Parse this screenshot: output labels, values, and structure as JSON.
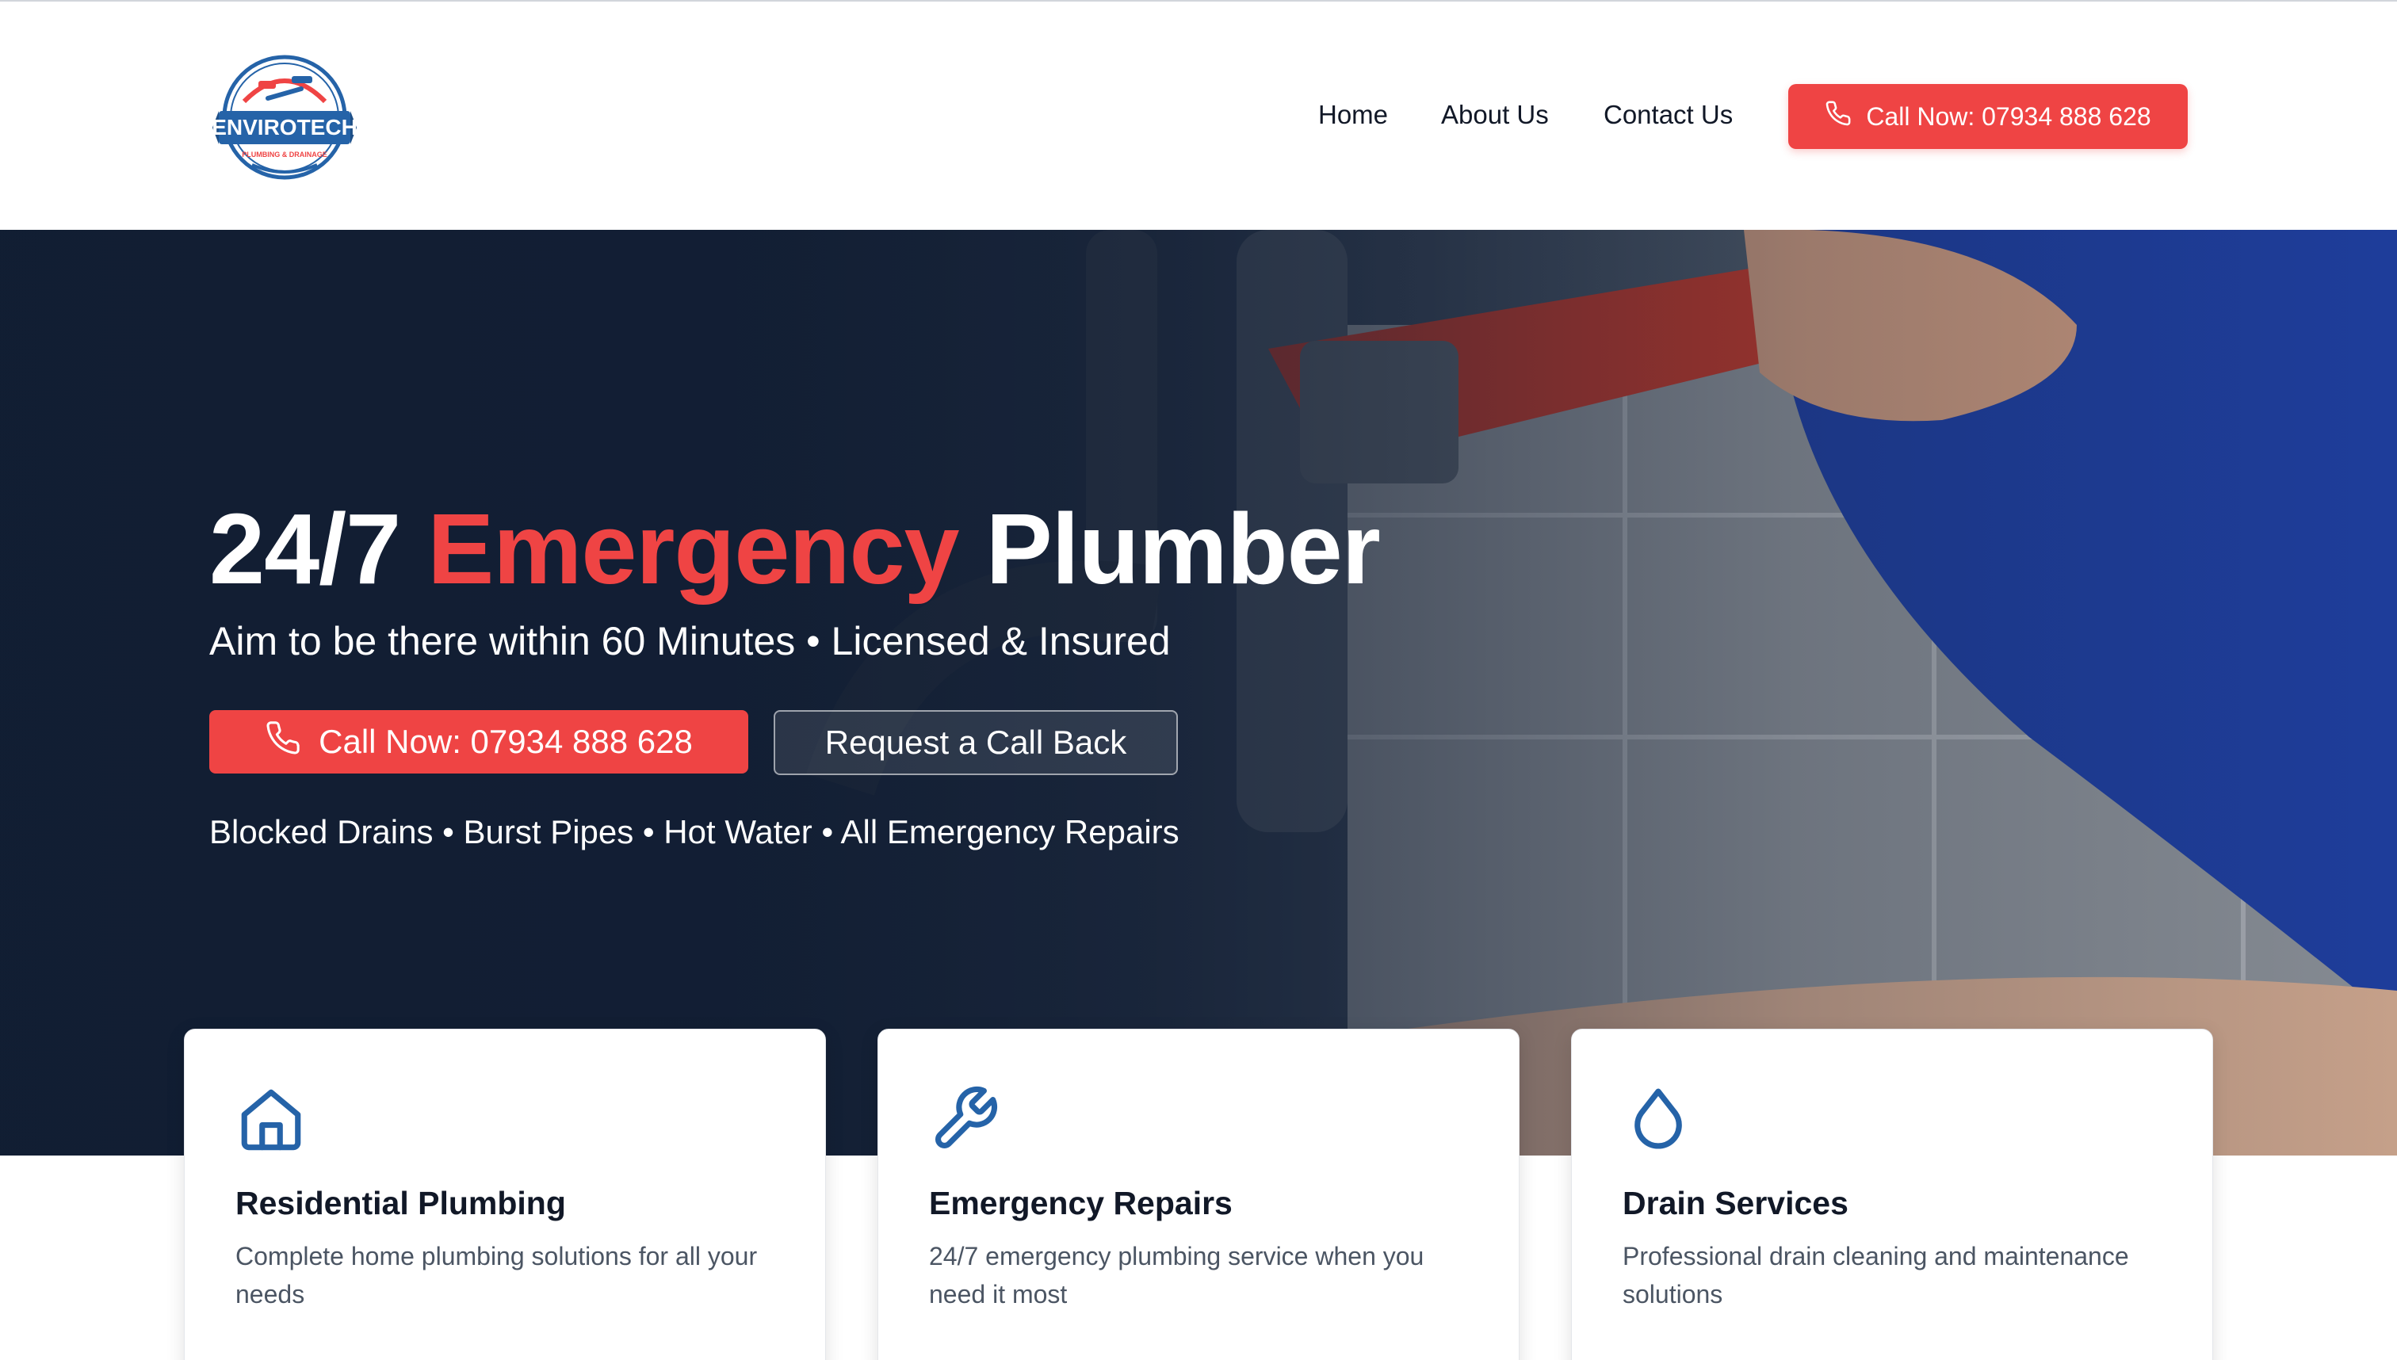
{
  "brand": {
    "logo_text": "ENVIROTECH",
    "logo_subtext": "PLUMBING & DRAINAGE"
  },
  "nav": {
    "items": [
      "Home",
      "About Us",
      "Contact Us"
    ],
    "call_button": "Call Now: 07934 888 628"
  },
  "hero": {
    "title_part1": "24/7 ",
    "title_accent": "Emergency",
    "title_part2": " Plumber",
    "subtitle": "Aim to be there within 60 Minutes • Licensed & Insured",
    "call_button": "Call Now: 07934 888 628",
    "callback_button": "Request a Call Back",
    "services_line": "Blocked Drains • Burst Pipes • Hot Water • All Emergency Repairs"
  },
  "cards": [
    {
      "icon": "house-icon",
      "title": "Residential Plumbing",
      "description": "Complete home plumbing solutions for all your needs"
    },
    {
      "icon": "wrench-icon",
      "title": "Emergency Repairs",
      "description": "24/7 emergency plumbing service when you need it most"
    },
    {
      "icon": "water-drop-icon",
      "title": "Drain Services",
      "description": "Professional drain cleaning and maintenance solutions"
    }
  ],
  "colors": {
    "accent_red": "#ef4444",
    "hero_navy": "#15233b",
    "icon_blue": "#2563a8",
    "text_dark": "#111827",
    "text_muted": "#4b5563"
  }
}
